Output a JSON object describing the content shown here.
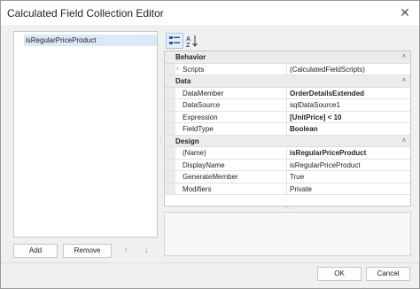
{
  "window": {
    "title": "Calculated Field Collection Editor"
  },
  "list": {
    "items": [
      {
        "label": "isRegularPriceProduct"
      }
    ]
  },
  "list_buttons": {
    "add": "Add",
    "remove": "Remove"
  },
  "icons": {
    "close": "close-icon",
    "up": "arrow-up-icon",
    "down": "arrow-down-icon",
    "categorized": "categorized-icon",
    "alphabetical": "sort-alphabetical-icon"
  },
  "properties": {
    "categories": [
      {
        "name": "Behavior",
        "rows": [
          {
            "name": "Scripts",
            "value": "(CalculatedFieldScripts)",
            "expandable": true
          }
        ]
      },
      {
        "name": "Data",
        "rows": [
          {
            "name": "DataMember",
            "value": "OrderDetailsExtended",
            "bold": true
          },
          {
            "name": "DataSource",
            "value": "sqlDataSource1",
            "bold": false
          },
          {
            "name": "Expression",
            "value": "[UnitPrice] < 10",
            "bold": true
          },
          {
            "name": "FieldType",
            "value": "Boolean",
            "bold": true
          }
        ]
      },
      {
        "name": "Design",
        "rows": [
          {
            "name": "(Name)",
            "value": "isRegularPriceProduct",
            "bold": true
          },
          {
            "name": "DisplayName",
            "value": "isRegularPriceProduct",
            "bold": false
          },
          {
            "name": "GenerateMember",
            "value": "True",
            "bold": false
          },
          {
            "name": "Modifiers",
            "value": "Private",
            "bold": false
          }
        ]
      }
    ]
  },
  "footer": {
    "ok": "OK",
    "cancel": "Cancel"
  }
}
